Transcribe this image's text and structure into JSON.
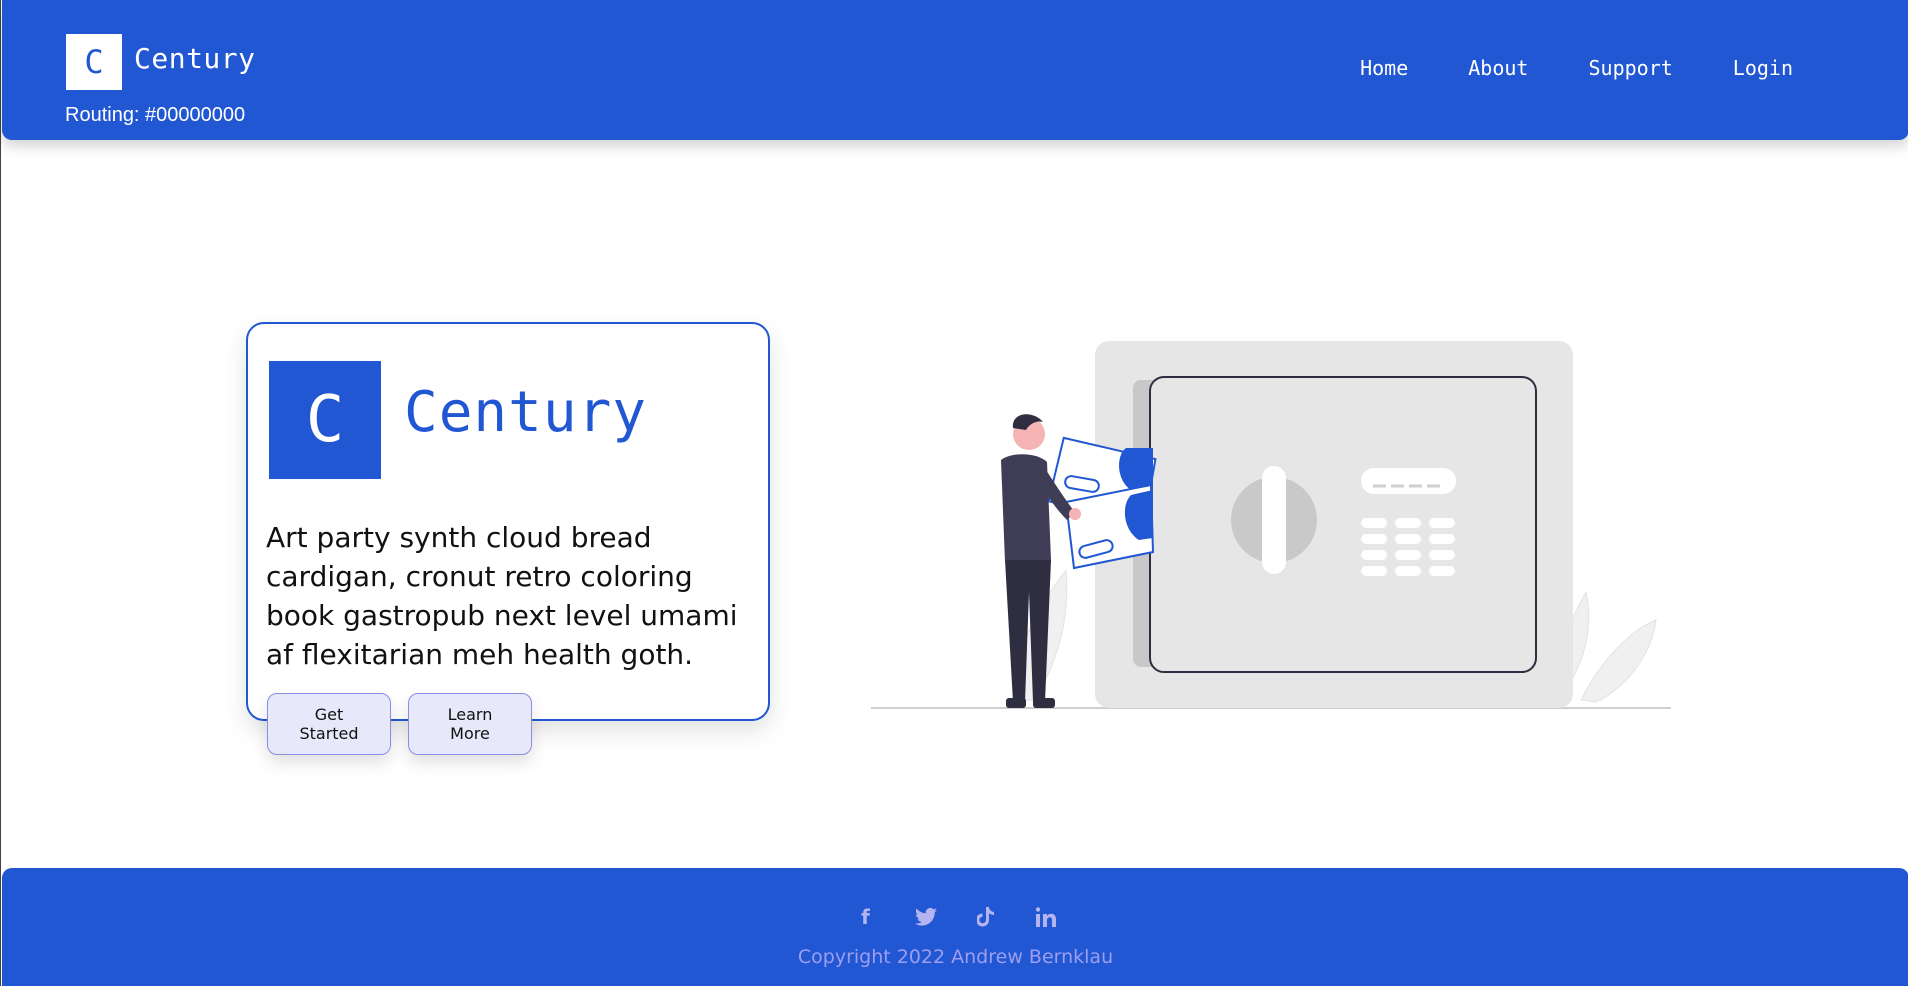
{
  "header": {
    "logo_letter": "C",
    "brand": "Century",
    "routing": "Routing: #00000000",
    "nav": [
      "Home",
      "About",
      "Support",
      "Login"
    ]
  },
  "hero": {
    "logo_letter": "C",
    "brand": "Century",
    "text": "Art party synth cloud bread cardigan, cronut retro coloring book gastropub next level umami af flexitarian meh health goth.",
    "buttons": {
      "get_started": "Get Started",
      "learn_more": "Learn More"
    }
  },
  "illustration": {
    "subject": "person depositing money into a safe"
  },
  "footer": {
    "social_icons": [
      "facebook-icon",
      "twitter-icon",
      "tiktok-icon",
      "linkedin-icon"
    ],
    "copyright": "Copyright 2022 Andrew Bernklau"
  },
  "colors": {
    "brand": "#2157d2",
    "button_bg": "#e8e8fb",
    "button_border": "#8c8ce6"
  }
}
